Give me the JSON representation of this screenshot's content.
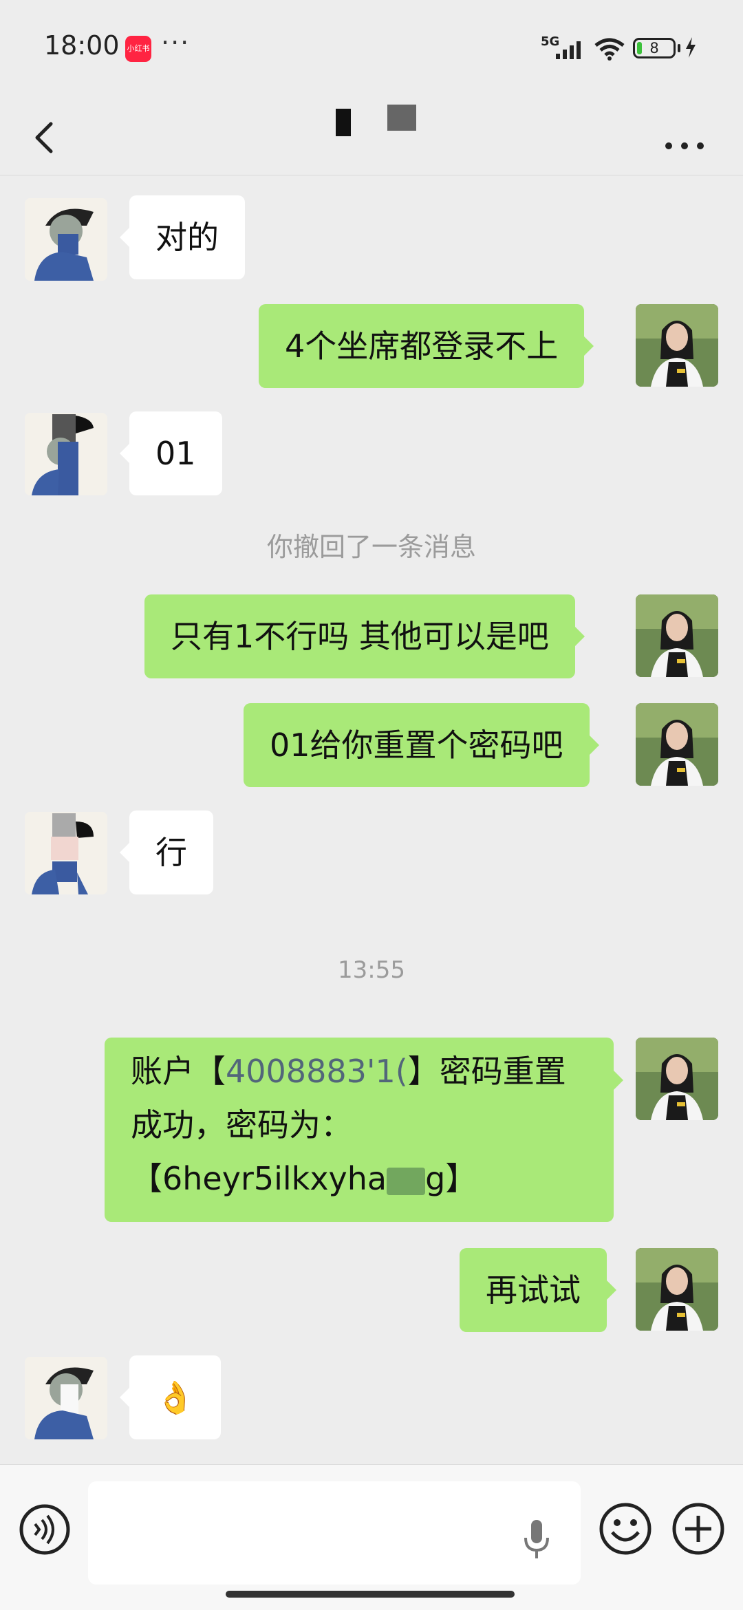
{
  "status_bar": {
    "time": "18:00",
    "app_badge": "小红书",
    "dots": "···",
    "network": "5G",
    "battery": "8"
  },
  "nav": {
    "back_icon": "chevron-left-icon",
    "more_icon": "more-horizontal-icon"
  },
  "messages": [
    {
      "side": "in",
      "text": "对的"
    },
    {
      "side": "out",
      "text": "4个坐席都登录不上"
    },
    {
      "side": "in",
      "text": "01"
    },
    {
      "side": "system",
      "text": "你撤回了一条消息"
    },
    {
      "side": "out",
      "text": "只有1不行吗 其他可以是吧"
    },
    {
      "side": "out",
      "text": "01给你重置个密码吧"
    },
    {
      "side": "in",
      "text": "行"
    },
    {
      "side": "timestamp",
      "text": "13:55"
    },
    {
      "side": "out",
      "text_prefix": "账户【",
      "text_account": "4008883'1(",
      "text_suffix": "】密码重置成功，密码为：",
      "text_password": "【6heyr5ilkxyha",
      "text_password_end": "g】"
    },
    {
      "side": "out",
      "text": "再试试"
    },
    {
      "side": "in",
      "text": "👌"
    }
  ],
  "input_bar": {
    "voice_icon": "voice-icon",
    "mic_icon": "mic-icon",
    "emoji_icon": "emoji-icon",
    "plus_icon": "plus-icon"
  }
}
